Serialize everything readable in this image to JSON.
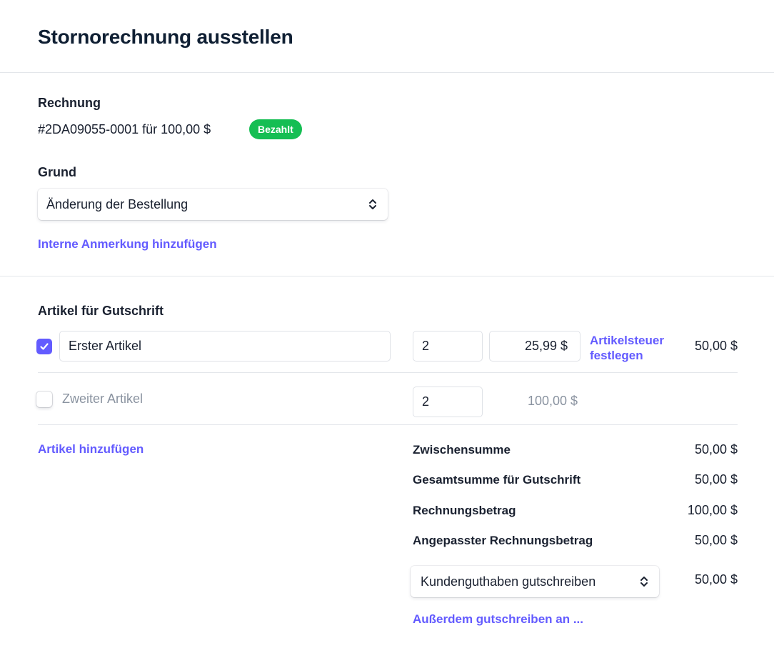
{
  "header": {
    "title": "Stornorechnung ausstellen"
  },
  "invoice": {
    "label": "Rechnung",
    "summary": "#2DA09055-0001 für 100,00 $",
    "status_badge": "Bezahlt",
    "status_color": "#15be53"
  },
  "reason": {
    "label": "Grund",
    "selected": "Änderung der Bestellung"
  },
  "internal_note_link": "Interne Anmerkung hinzufügen",
  "items_section": {
    "label": "Artikel für Gutschrift",
    "items": [
      {
        "checked": true,
        "name": "Erster Artikel",
        "quantity": "2",
        "unit_price": "25,99 $",
        "tax_link_line1": "Artikelsteuer",
        "tax_link_line2": "festlegen",
        "line_total": "50,00 $"
      },
      {
        "checked": false,
        "name": "Zweiter Artikel",
        "quantity": "2",
        "unit_price": "100,00 $"
      }
    ],
    "add_item_link": "Artikel hinzufügen"
  },
  "totals": {
    "subtotal_label": "Zwischensumme",
    "subtotal_value": "50,00 $",
    "credit_total_label": "Gesamtsumme für Gutschrift",
    "credit_total_value": "50,00 $",
    "invoice_amount_label": "Rechnungsbetrag",
    "invoice_amount_value": "100,00 $",
    "adjusted_amount_label": "Angepasster Rechnungsbetrag",
    "adjusted_amount_value": "50,00 $"
  },
  "credit_method": {
    "selected": "Kundenguthaben gutschreiben",
    "value": "50,00 $",
    "also_credit_link": "Außerdem gutschreiben an ..."
  },
  "colors": {
    "accent": "#635bff",
    "text": "#1a2130",
    "divider": "#e3e6ea"
  }
}
